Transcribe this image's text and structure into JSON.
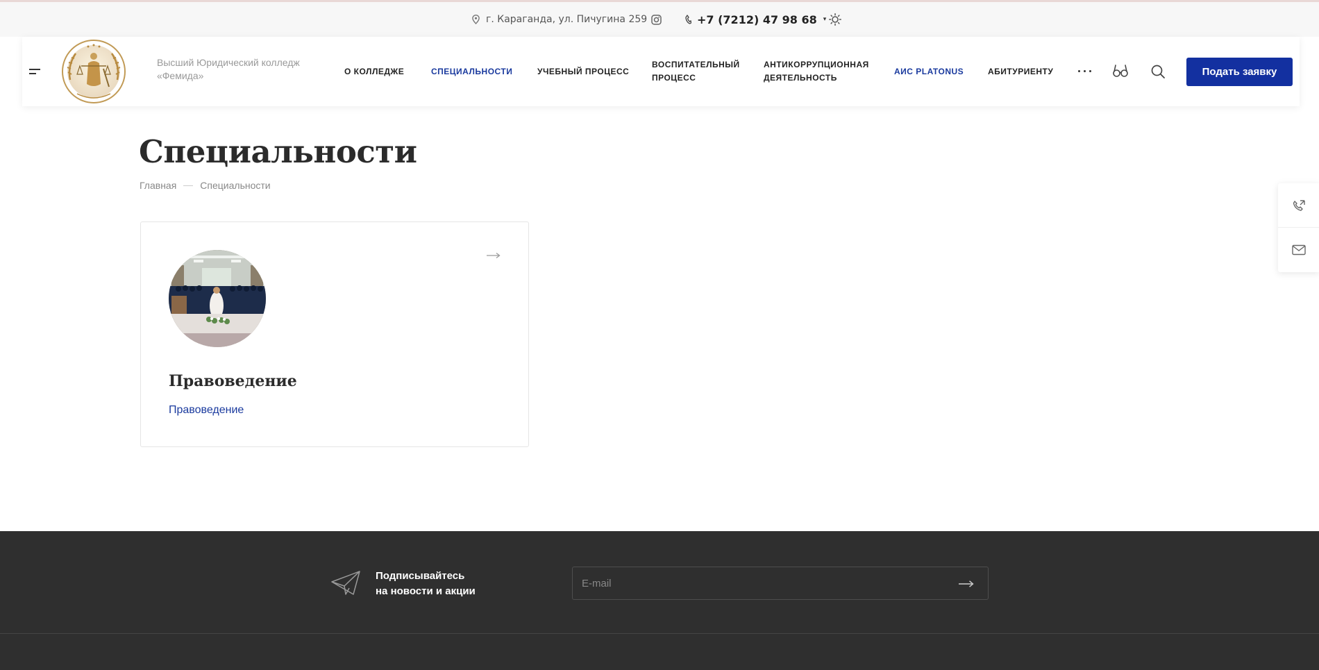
{
  "topbar": {
    "address": "г. Караганда, ул. Пичугина 259",
    "phone": "+7 (7212) 47 98 68",
    "phone_caret": "▾",
    "icons": [
      "location-pin-icon",
      "instagram-icon",
      "phone-icon",
      "sun-icon"
    ]
  },
  "header": {
    "site_title": "Высший Юридический колледж «Фемида»",
    "nav": [
      {
        "label": "О колледже"
      },
      {
        "label": "Специальности",
        "active": true
      },
      {
        "label": "Учебный процесс"
      },
      {
        "label": "Воспитательный процесс"
      },
      {
        "label": "Антикоррупционная деятельность"
      },
      {
        "label": "АИС Platonus",
        "accent": true
      },
      {
        "label": "Абитуриенту"
      }
    ],
    "apply_button": "Подать заявку",
    "icons": [
      "menu-burger-icon",
      "more-dots-icon",
      "low-vision-glasses-icon",
      "search-icon"
    ]
  },
  "page": {
    "title": "Специальности",
    "breadcrumb": [
      "Главная",
      "Специальности"
    ]
  },
  "cards": [
    {
      "title": "Правоведение",
      "link": "Правоведение"
    }
  ],
  "footer": {
    "subscribe_line1": "Подписывайтесь",
    "subscribe_line2": "на новости и акции",
    "email_placeholder": "E-mail"
  },
  "colors": {
    "accent": "#1330a0",
    "link": "#1a3a9e",
    "footer_bg": "#2f2f2f",
    "topbar_bg": "#f7f7f7"
  }
}
